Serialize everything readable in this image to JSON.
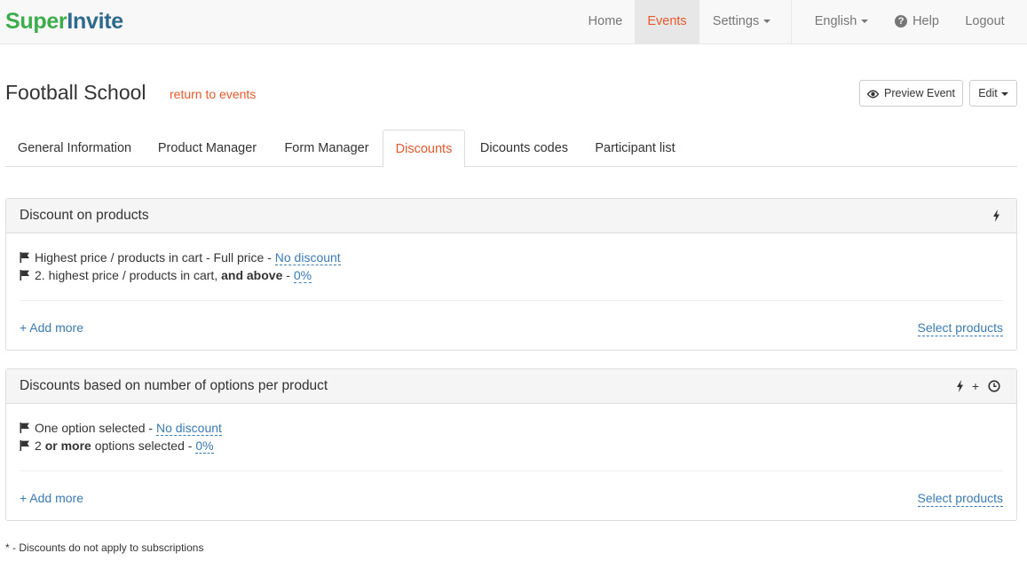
{
  "brand": {
    "part1": "Super",
    "part2": "Invite"
  },
  "nav": {
    "home": "Home",
    "events": "Events",
    "settings": "Settings",
    "language": "English",
    "help": "Help",
    "logout": "Logout"
  },
  "header": {
    "title": "Football School",
    "return_link": "return to events",
    "preview_button": "Preview Event",
    "edit_button": "Edit"
  },
  "tabs": [
    {
      "label": "General Information"
    },
    {
      "label": "Product Manager"
    },
    {
      "label": "Form Manager"
    },
    {
      "label": "Discounts",
      "active": true
    },
    {
      "label": "Dicounts codes"
    },
    {
      "label": "Participant list"
    }
  ],
  "panels": [
    {
      "title": "Discount on products",
      "icons": [
        "bolt-icon"
      ],
      "rules": [
        {
          "prefix": "Highest price / products in cart - Full price - ",
          "bold": "",
          "suffix": "",
          "value": "No discount"
        },
        {
          "prefix": "2. highest price / products in cart, ",
          "bold": "and above",
          "suffix": " - ",
          "value": "0%"
        }
      ],
      "add_more": "+ Add more",
      "select_products": "Select products"
    },
    {
      "title": "Discounts based on number of options per product",
      "icons": [
        "bolt-icon",
        "plus",
        "clock-icon"
      ],
      "plus_text": "+",
      "rules": [
        {
          "prefix": "One option selected - ",
          "bold": "",
          "suffix": "",
          "value": "No discount"
        },
        {
          "prefix": "2 ",
          "bold": "or more",
          "suffix": " options selected - ",
          "value": "0%"
        }
      ],
      "add_more": "+ Add more",
      "select_products": "Select products"
    }
  ],
  "footnote": "* - Discounts do not apply to subscriptions",
  "colors": {
    "accent": "#e8582b",
    "link": "#3a7ab5",
    "brand_green": "#3cad4a",
    "brand_blue": "#2d6a8e"
  }
}
